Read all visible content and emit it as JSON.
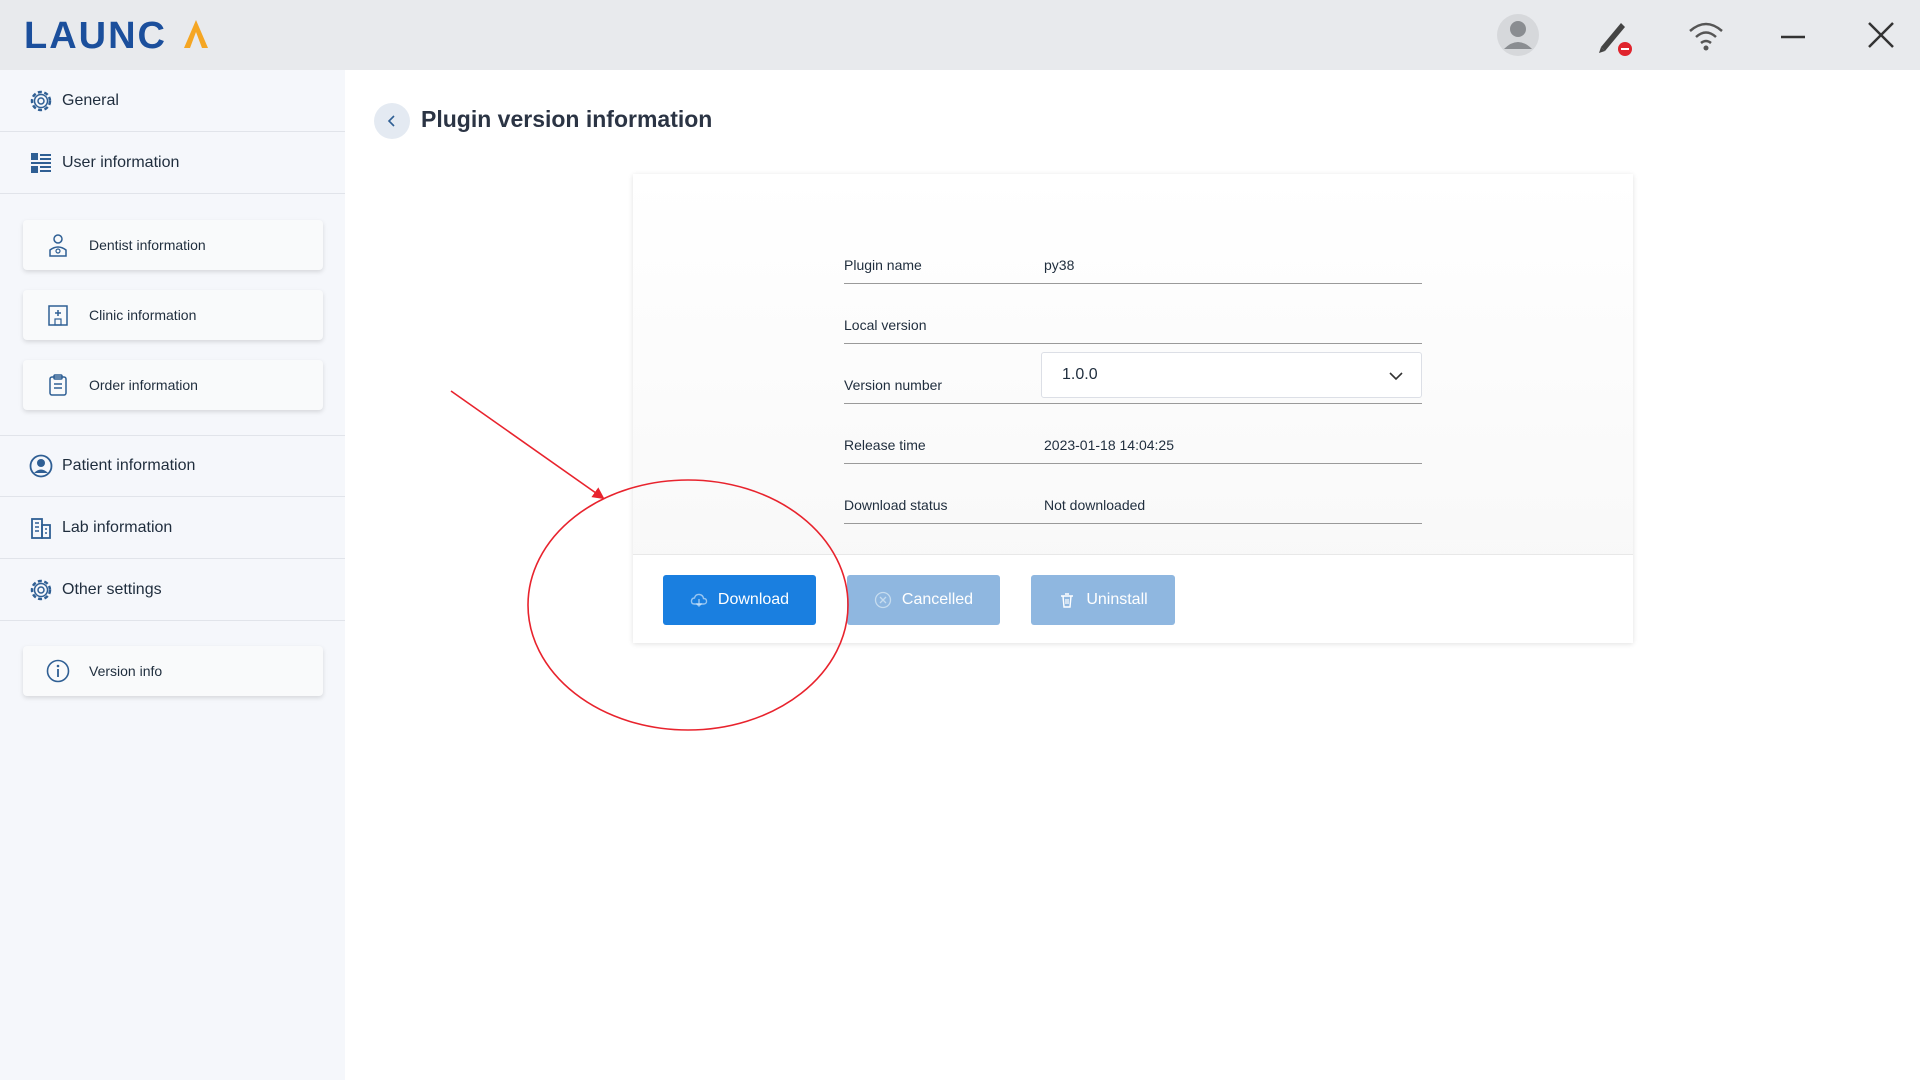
{
  "app": {
    "logo_text": "LAUNCA",
    "title_icons": [
      "user-avatar-icon",
      "pen-disconnected-icon",
      "wifi-icon",
      "minimize-icon",
      "close-icon"
    ]
  },
  "sidebar": {
    "items": [
      {
        "label": "General",
        "icon": "gear-icon"
      },
      {
        "label": "User information",
        "icon": "grid-list-icon"
      },
      {
        "label": "Dentist information",
        "icon": "dentist-icon"
      },
      {
        "label": "Clinic information",
        "icon": "clinic-icon"
      },
      {
        "label": "Order information",
        "icon": "clipboard-icon"
      },
      {
        "label": "Patient information",
        "icon": "person-circle-icon"
      },
      {
        "label": "Lab information",
        "icon": "building-icon"
      },
      {
        "label": "Other settings",
        "icon": "gear-icon"
      },
      {
        "label": "Version info",
        "icon": "info-icon"
      }
    ]
  },
  "main": {
    "title": "Plugin version information",
    "fields": {
      "plugin_name_label": "Plugin name",
      "plugin_name_value": "py38",
      "local_version_label": "Local version",
      "local_version_value": "",
      "version_number_label": "Version number",
      "version_number_value": "1.0.0",
      "release_time_label": "Release time",
      "release_time_value": "2023-01-18 14:04:25",
      "download_status_label": "Download status",
      "download_status_value": "Not downloaded"
    },
    "buttons": {
      "download": "Download",
      "cancelled": "Cancelled",
      "uninstall": "Uninstall"
    }
  },
  "colors": {
    "accent": "#1a7fe0",
    "disabled_button": "#8fb7e0",
    "annotation": "#e8232d",
    "logo_blue": "#1b4f9c",
    "logo_orange": "#f5a623"
  }
}
